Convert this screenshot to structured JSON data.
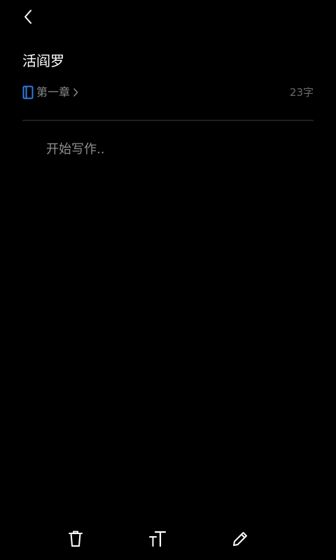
{
  "header": {
    "back_icon": "chevron-left-icon"
  },
  "document": {
    "title": "活阎罗",
    "chapter_label": "第一章",
    "chapter_icon": "book-icon",
    "word_count": "23字"
  },
  "editor": {
    "placeholder": "开始写作..",
    "value": ""
  },
  "toolbar": {
    "items": [
      {
        "icon": "trash-icon"
      },
      {
        "icon": "text-size-icon"
      },
      {
        "icon": "pencil-icon"
      }
    ]
  },
  "colors": {
    "background": "#000000",
    "accent": "#2f7de1",
    "text_primary": "#ffffff",
    "text_secondary": "#8a8a8a",
    "divider": "#1e1e1e"
  }
}
